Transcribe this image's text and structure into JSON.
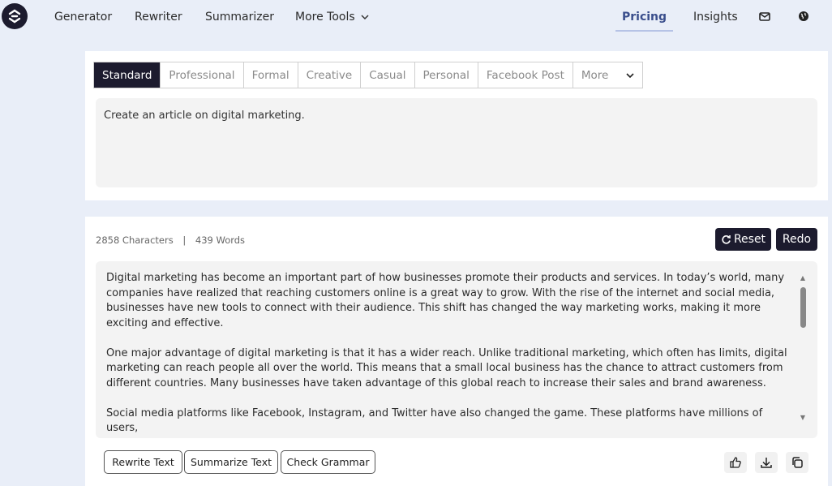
{
  "nav": {
    "logo_icon": "logo-icon",
    "links": [
      "Generator",
      "Rewriter",
      "Summarizer",
      "More Tools"
    ],
    "pricing": "Pricing",
    "insights": "Insights",
    "icons": [
      "mail-icon",
      "globe-icon"
    ]
  },
  "tones": {
    "tabs": [
      "Standard",
      "Professional",
      "Formal",
      "Creative",
      "Casual",
      "Personal",
      "Facebook Post",
      "More"
    ],
    "active": "Standard"
  },
  "input": {
    "value": "Create an article on digital marketing."
  },
  "stats": {
    "characters": "2858 Characters",
    "separator": "|",
    "words": "439 Words"
  },
  "actions": {
    "reset": "Reset",
    "redo": "Redo"
  },
  "output": {
    "paragraphs": [
      "Digital marketing has become an important part of how businesses promote their products and services. In today’s world, many companies have realized that reaching customers online is a great way to grow. With the rise of the internet and social media, businesses have new tools to connect with their audience. This shift has changed the way marketing works, making it more exciting and effective.",
      "One major advantage of digital marketing is that it has a wider reach. Unlike traditional marketing, which often has limits, digital marketing can reach people all over the world. This means that a small local business has the chance to attract customers from different countries. Many businesses have taken advantage of this global reach to increase their sales and brand awareness.",
      "Social media platforms like Facebook, Instagram, and Twitter have also changed the game. These platforms have millions of users,"
    ]
  },
  "bottom_buttons": {
    "rewrite": "Rewrite Text",
    "summarize": "Summarize Text",
    "grammar": "Check Grammar"
  },
  "bottom_icons": [
    "thumbs-up-icon",
    "download-icon",
    "copy-icon"
  ],
  "colors": {
    "dark": "#1c1b2e",
    "accent": "#3a4e8c",
    "background": "#e9eef8"
  }
}
